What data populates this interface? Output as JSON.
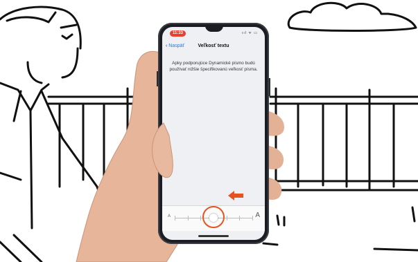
{
  "status": {
    "time": "11:33",
    "icons": "ııl ᯤ ▭"
  },
  "nav": {
    "back_label": "Naspäť",
    "title": "Veľkosť textu"
  },
  "content": {
    "description": "Apky podporujúce Dynamické písmo budú používať nižšie špecifikovanú veľkosť písma."
  },
  "slider": {
    "small_label": "A",
    "large_label": "A",
    "steps": 7,
    "value_index": 3
  },
  "colors": {
    "accent_blue": "#2b79e6",
    "time_pill": "#e8412f",
    "highlight": "#e5541f"
  },
  "icons": {
    "back": "chevron-left-icon",
    "pointer": "arrow-left-icon"
  }
}
